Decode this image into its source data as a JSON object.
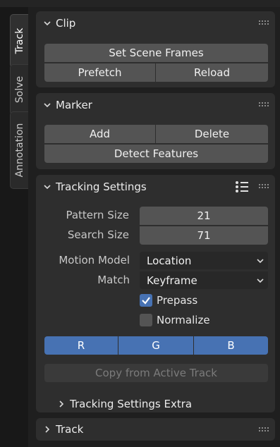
{
  "tabs": [
    {
      "label": "Track",
      "active": true
    },
    {
      "label": "Solve",
      "active": false
    },
    {
      "label": "Annotation",
      "active": false
    }
  ],
  "clip": {
    "title": "Clip",
    "set_scene_frames": "Set Scene Frames",
    "prefetch": "Prefetch",
    "reload": "Reload"
  },
  "marker": {
    "title": "Marker",
    "add": "Add",
    "delete": "Delete",
    "detect_features": "Detect Features"
  },
  "tracking_settings": {
    "title": "Tracking Settings",
    "pattern_size_label": "Pattern Size",
    "pattern_size_value": "21",
    "search_size_label": "Search Size",
    "search_size_value": "71",
    "motion_model_label": "Motion Model",
    "motion_model_value": "Location",
    "match_label": "Match",
    "match_value": "Keyframe",
    "prepass_label": "Prepass",
    "prepass_checked": true,
    "normalize_label": "Normalize",
    "normalize_checked": false,
    "channels": [
      "R",
      "G",
      "B"
    ],
    "copy_from_active": "Copy from Active Track",
    "extra_title": "Tracking Settings Extra"
  },
  "track": {
    "title": "Track"
  },
  "colors": {
    "accent": "#4772b3",
    "panel": "#2e2e2e",
    "button": "#545454",
    "dropdown": "#282828"
  }
}
